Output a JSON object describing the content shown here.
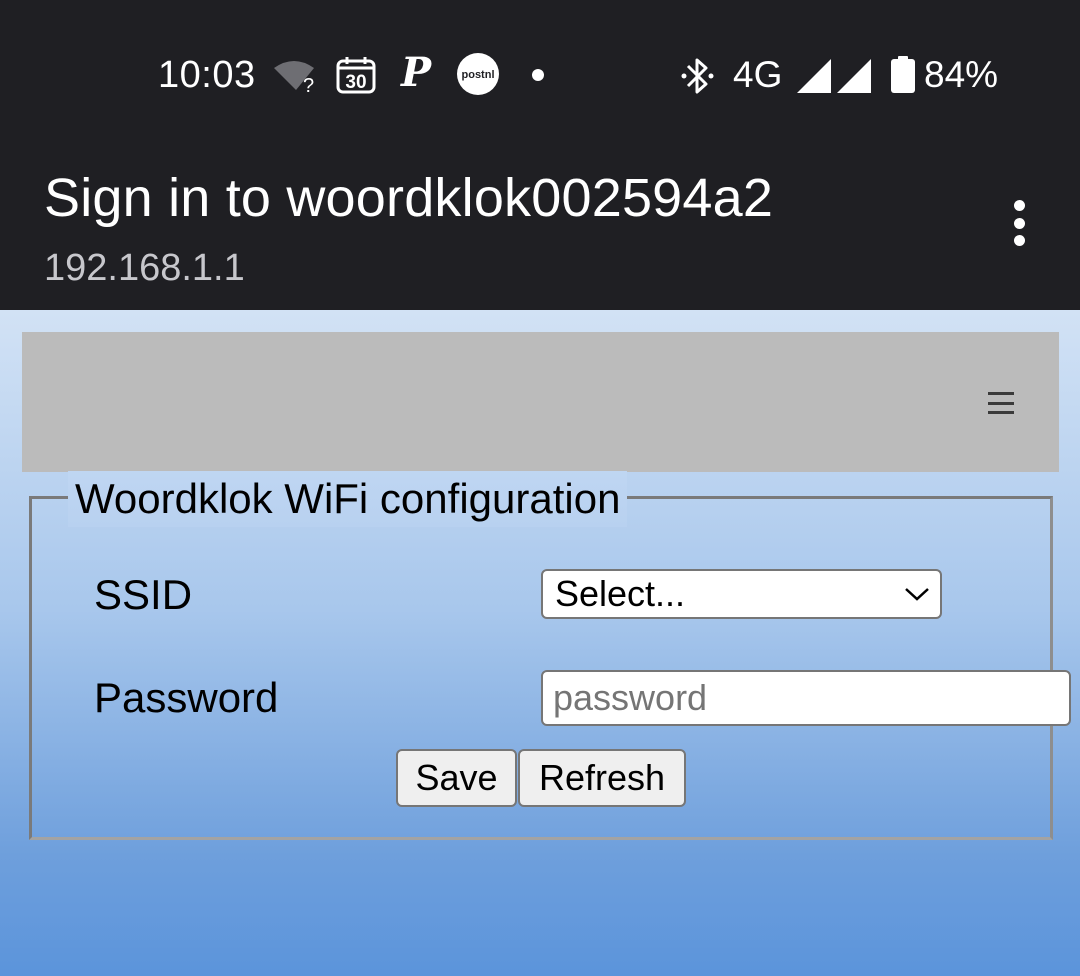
{
  "status_bar": {
    "time": "10:03",
    "calendar_day": "30",
    "p_icon_letter": "P",
    "postnl_logo_text": "postnl",
    "network": "4G",
    "battery": "84%"
  },
  "header": {
    "title": "Sign in to woordklok002594a2",
    "subtitle": "192.168.1.1"
  },
  "form": {
    "legend": "Woordklok WiFi configuration",
    "ssid_label": "SSID",
    "ssid_selected": "Select...",
    "password_label": "Password",
    "password_value": "",
    "password_placeholder": "password",
    "save_label": "Save",
    "refresh_label": "Refresh"
  },
  "icons": {
    "status": [
      "wifi-question-icon",
      "calendar-icon",
      "p-app-icon",
      "postnl-icon",
      "notification-dot-icon",
      "bluetooth-icon",
      "signal-icon",
      "signal-icon",
      "battery-icon"
    ],
    "header": [
      "more-vert-icon"
    ],
    "page": [
      "hamburger-menu-icon",
      "chevron-down-icon"
    ]
  },
  "colors": {
    "status_bar_bg": "#1f1f23",
    "top_bar_bg": "#bbbbbb",
    "gradient_top": "#d2e2f5",
    "gradient_bottom": "#5b94db"
  }
}
